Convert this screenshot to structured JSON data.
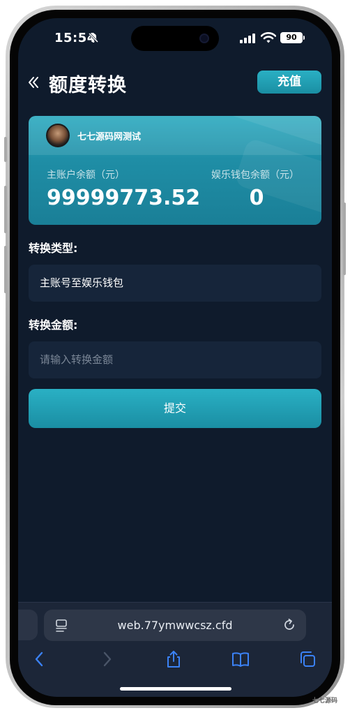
{
  "status_bar": {
    "time": "15:54",
    "battery": "90"
  },
  "header": {
    "title": "额度转换",
    "recharge_label": "充值"
  },
  "balance_card": {
    "username": "七七源码网测试",
    "main_balance_label": "主账户余额（元）",
    "main_balance_value": "99999773.52",
    "wallet_balance_label": "娱乐钱包余额（元）",
    "wallet_balance_value": "0"
  },
  "form": {
    "type_label": "转换类型:",
    "type_value": "主账号至娱乐钱包",
    "amount_label": "转换金额:",
    "amount_placeholder": "请输入转换金额",
    "amount_value": "",
    "submit_label": "提交"
  },
  "browser": {
    "url": "web.77ymwwcsz.cfd"
  },
  "watermark": "七七源码",
  "colors": {
    "background": "#0f1b2c",
    "accent": "#1f9fb5",
    "field": "#16253a"
  },
  "icons": {
    "back": "chevron-double-left-icon",
    "reader": "reader-mode-icon",
    "reload": "reload-icon",
    "nav_back": "chevron-left-icon",
    "nav_forward": "chevron-right-icon",
    "share": "share-icon",
    "bookmarks": "bookmarks-icon",
    "tabs": "tabs-icon"
  }
}
